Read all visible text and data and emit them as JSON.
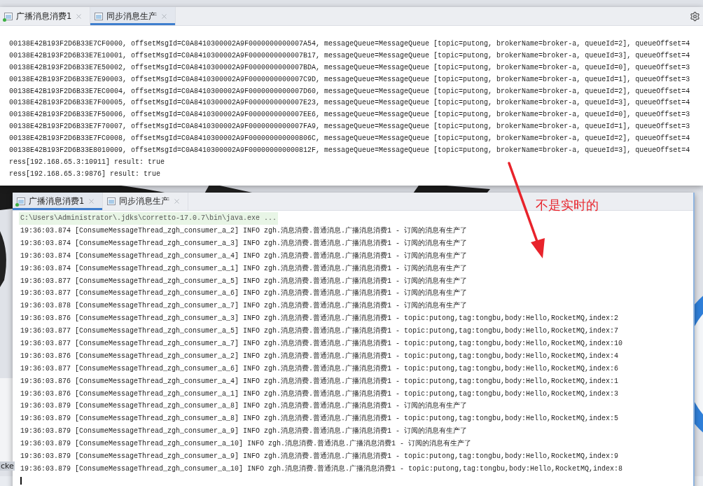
{
  "desktop_label": "cke",
  "windows": [
    {
      "tabs": [
        {
          "label": "广播消息消费1",
          "selected": false,
          "running": true
        },
        {
          "label": "同步消息生产",
          "selected": true,
          "running": false
        }
      ],
      "lines": [
        "00138E42B193F2D6B33E7CF0000, offsetMsgId=C0A8410300002A9F0000000000007A54, messageQueue=MessageQueue [topic=putong, brokerName=broker-a, queueId=2], queueOffset=4",
        "00138E42B193F2D6B33E7E10001, offsetMsgId=C0A8410300002A9F0000000000007B17, messageQueue=MessageQueue [topic=putong, brokerName=broker-a, queueId=3], queueOffset=4",
        "00138E42B193F2D6B33E7E50002, offsetMsgId=C0A8410300002A9F0000000000007BDA, messageQueue=MessageQueue [topic=putong, brokerName=broker-a, queueId=0], queueOffset=3",
        "00138E42B193F2D6B33E7E90003, offsetMsgId=C0A8410300002A9F0000000000007C9D, messageQueue=MessageQueue [topic=putong, brokerName=broker-a, queueId=1], queueOffset=3",
        "00138E42B193F2D6B33E7EC0004, offsetMsgId=C0A8410300002A9F0000000000007D60, messageQueue=MessageQueue [topic=putong, brokerName=broker-a, queueId=2], queueOffset=4",
        "00138E42B193F2D6B33E7F00005, offsetMsgId=C0A8410300002A9F0000000000007E23, messageQueue=MessageQueue [topic=putong, brokerName=broker-a, queueId=3], queueOffset=4",
        "00138E42B193F2D6B33E7F50006, offsetMsgId=C0A8410300002A9F0000000000007EE6, messageQueue=MessageQueue [topic=putong, brokerName=broker-a, queueId=0], queueOffset=3",
        "00138E42B193F2D6B33E7F70007, offsetMsgId=C0A8410300002A9F0000000000007FA9, messageQueue=MessageQueue [topic=putong, brokerName=broker-a, queueId=1], queueOffset=3",
        "00138E42B193F2D6B33E7FC0008, offsetMsgId=C0A8410300002A9F000000000000806C, messageQueue=MessageQueue [topic=putong, brokerName=broker-a, queueId=2], queueOffset=4",
        "00138E42B193F2D6B33E8010009, offsetMsgId=C0A8410300002A9F000000000000812F, messageQueue=MessageQueue [topic=putong, brokerName=broker-a, queueId=3], queueOffset=4",
        "ress[192.168.65.3:10911] result: true",
        "ress[192.168.65.3:9876] result: true"
      ]
    },
    {
      "tabs": [
        {
          "label": "广播消息消费1",
          "selected": true,
          "running": true
        },
        {
          "label": "同步消息生产",
          "selected": false,
          "running": false
        }
      ],
      "command": "C:\\Users\\Administrator\\.jdks\\corretto-17.0.7\\bin\\java.exe ...",
      "lines": [
        "19:36:03.874 [ConsumeMessageThread_zgh_consumer_a_2] INFO zgh.消息消费.普通消息.广播消息消费1 - 订阅的消息有生产了",
        "19:36:03.874 [ConsumeMessageThread_zgh_consumer_a_3] INFO zgh.消息消费.普通消息.广播消息消费1 - 订阅的消息有生产了",
        "19:36:03.874 [ConsumeMessageThread_zgh_consumer_a_4] INFO zgh.消息消费.普通消息.广播消息消费1 - 订阅的消息有生产了",
        "19:36:03.874 [ConsumeMessageThread_zgh_consumer_a_1] INFO zgh.消息消费.普通消息.广播消息消费1 - 订阅的消息有生产了",
        "19:36:03.877 [ConsumeMessageThread_zgh_consumer_a_5] INFO zgh.消息消费.普通消息.广播消息消费1 - 订阅的消息有生产了",
        "19:36:03.877 [ConsumeMessageThread_zgh_consumer_a_6] INFO zgh.消息消费.普通消息.广播消息消费1 - 订阅的消息有生产了",
        "19:36:03.878 [ConsumeMessageThread_zgh_consumer_a_7] INFO zgh.消息消费.普通消息.广播消息消费1 - 订阅的消息有生产了",
        "19:36:03.876 [ConsumeMessageThread_zgh_consumer_a_3] INFO zgh.消息消费.普通消息.广播消息消费1 - topic:putong,tag:tongbu,body:Hello,RocketMQ,index:2",
        "19:36:03.877 [ConsumeMessageThread_zgh_consumer_a_5] INFO zgh.消息消费.普通消息.广播消息消费1 - topic:putong,tag:tongbu,body:Hello,RocketMQ,index:7",
        "19:36:03.877 [ConsumeMessageThread_zgh_consumer_a_7] INFO zgh.消息消费.普通消息.广播消息消费1 - topic:putong,tag:tongbu,body:Hello,RocketMQ,index:10",
        "19:36:03.876 [ConsumeMessageThread_zgh_consumer_a_2] INFO zgh.消息消费.普通消息.广播消息消费1 - topic:putong,tag:tongbu,body:Hello,RocketMQ,index:4",
        "19:36:03.877 [ConsumeMessageThread_zgh_consumer_a_6] INFO zgh.消息消费.普通消息.广播消息消费1 - topic:putong,tag:tongbu,body:Hello,RocketMQ,index:6",
        "19:36:03.876 [ConsumeMessageThread_zgh_consumer_a_4] INFO zgh.消息消费.普通消息.广播消息消费1 - topic:putong,tag:tongbu,body:Hello,RocketMQ,index:1",
        "19:36:03.876 [ConsumeMessageThread_zgh_consumer_a_1] INFO zgh.消息消费.普通消息.广播消息消费1 - topic:putong,tag:tongbu,body:Hello,RocketMQ,index:3",
        "19:36:03.879 [ConsumeMessageThread_zgh_consumer_a_8] INFO zgh.消息消费.普通消息.广播消息消费1 - 订阅的消息有生产了",
        "19:36:03.879 [ConsumeMessageThread_zgh_consumer_a_8] INFO zgh.消息消费.普通消息.广播消息消费1 - topic:putong,tag:tongbu,body:Hello,RocketMQ,index:5",
        "19:36:03.879 [ConsumeMessageThread_zgh_consumer_a_9] INFO zgh.消息消费.普通消息.广播消息消费1 - 订阅的消息有生产了",
        "19:36:03.879 [ConsumeMessageThread_zgh_consumer_a_10] INFO zgh.消息消费.普通消息.广播消息消费1 - 订阅的消息有生产了",
        "19:36:03.879 [ConsumeMessageThread_zgh_consumer_a_9] INFO zgh.消息消费.普通消息.广播消息消费1 - topic:putong,tag:tongbu,body:Hello,RocketMQ,index:9",
        "19:36:03.879 [ConsumeMessageThread_zgh_consumer_a_10] INFO zgh.消息消费.普通消息.广播消息消费1 - topic:putong,tag:tongbu,body:Hello,RocketMQ,index:8"
      ]
    }
  ],
  "annotation": {
    "text": "不是实时的"
  }
}
